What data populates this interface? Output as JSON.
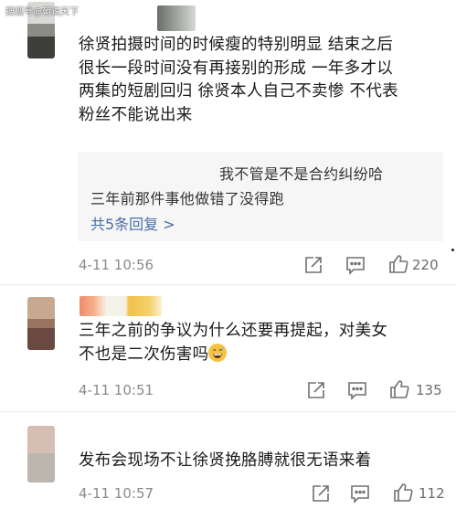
{
  "watermark": "搜狐号@朝说天下",
  "comments": [
    {
      "text": "徐贤拍摄时间的时候瘦的特别明显 结束之后很长一段时间没有再接别的形成 一年多才以两集的短剧回归 徐贤本人自己不卖惨 不代表粉丝不能说出来",
      "lines": [
        "徐贤拍摄时间的时候瘦的特别明显 结束之后",
        "很长一段时间没有再接别的形成 一年多才以",
        "两集的短剧回归 徐贤本人自己不卖惨 不代表",
        "粉丝不能说出来"
      ],
      "replies": [
        "我不管是不是合约纠纷哈",
        "三年前那件事他做错了没得跑"
      ],
      "more_replies": "共5条回复 >",
      "time": "4-11 10:56",
      "likes": "220"
    },
    {
      "lines": [
        "三年之前的争议为什么还要再提起，对美女",
        "不也是二次伤害吗"
      ],
      "emoji": "grinning-sweat-emoji",
      "time": "4-11 10:51",
      "likes": "135"
    },
    {
      "lines": [
        "发布会现场不让徐贤挽胳膊就很无语来着"
      ],
      "time": "4-11 10:57",
      "likes": "112"
    }
  ],
  "icons": [
    "share-icon",
    "reply-icon",
    "like-icon"
  ],
  "colors": {
    "reply_link": "#4a6fa5",
    "reply_bg": "#f6f6f7",
    "meta_gray": "#8a8a8a"
  }
}
